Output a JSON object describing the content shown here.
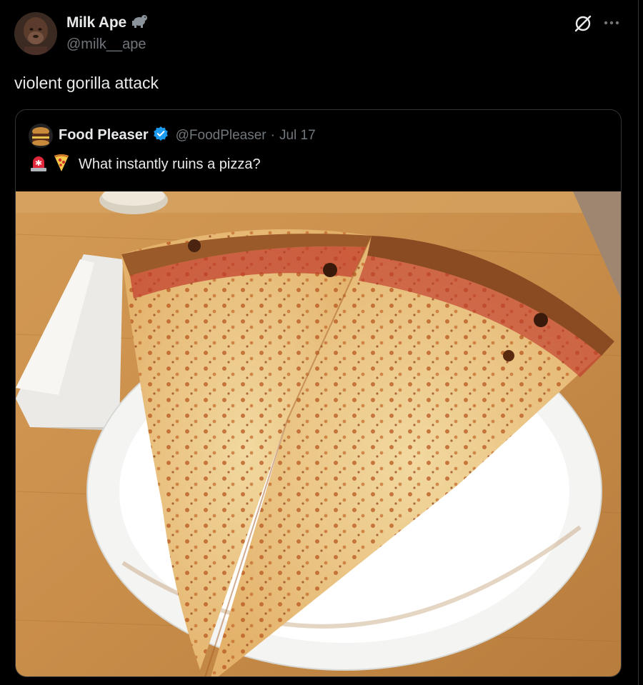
{
  "tweet": {
    "author": {
      "display_name": "Milk Ape",
      "handle": "@milk__ape",
      "badge_icon": "gorilla-emoji-icon"
    },
    "text": "violent gorilla attack",
    "icons": [
      "grok-icon",
      "more-icon"
    ]
  },
  "quoted_tweet": {
    "author": {
      "display_name": "Food Pleaser",
      "verified_icon": "verified-badge-icon",
      "handle": "@FoodPleaser",
      "date": "Jul 17",
      "separator": "·"
    },
    "text_icons": [
      "siren-emoji-icon",
      "pizza-emoji-icon"
    ],
    "text": "What instantly ruins a pizza?",
    "media": "photo of two cheese pizza slices on a white paper plate on a wooden table"
  },
  "colors": {
    "background": "#000000",
    "text_primary": "#e7e9ea",
    "text_secondary": "#71767b",
    "border": "#2f3336",
    "verified": "#1d9bf0"
  }
}
